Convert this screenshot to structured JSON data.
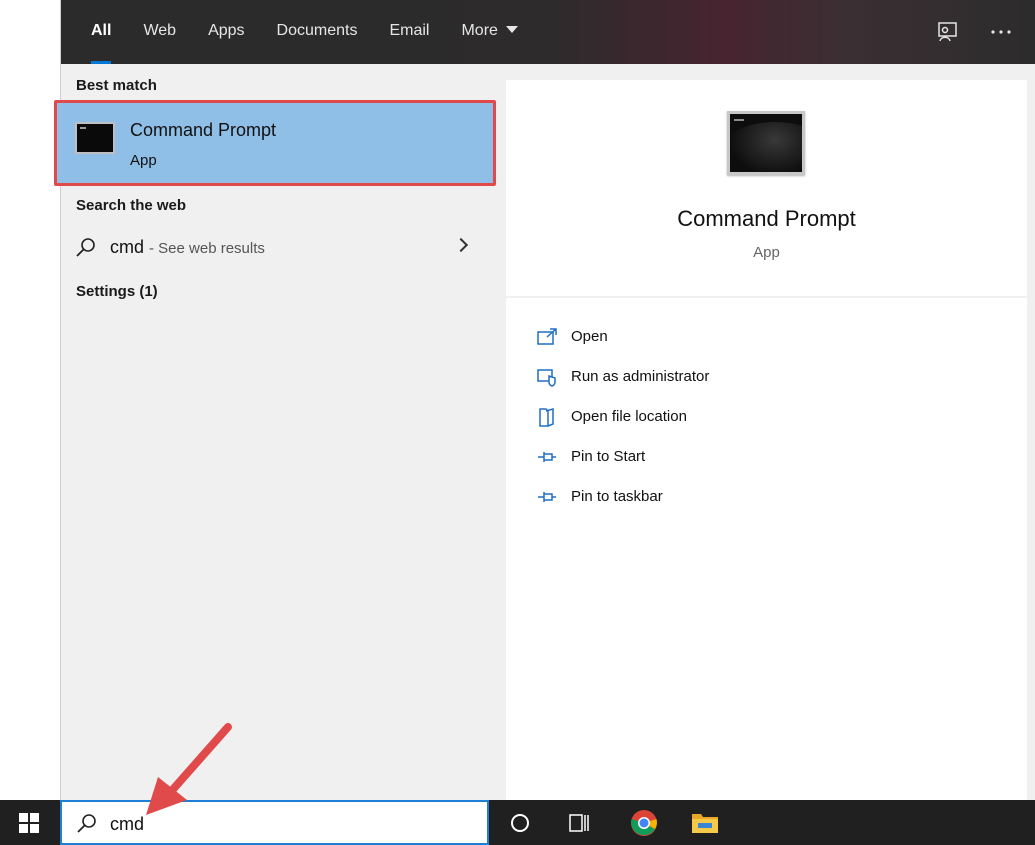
{
  "header": {
    "tabs": [
      {
        "label": "All"
      },
      {
        "label": "Web"
      },
      {
        "label": "Apps"
      },
      {
        "label": "Documents"
      },
      {
        "label": "Email"
      },
      {
        "label": "More"
      }
    ],
    "icons": [
      "feedback-icon",
      "more-options-icon"
    ]
  },
  "results": {
    "best_match_title": "Best match",
    "best_match": {
      "name": "Command Prompt",
      "type": "App"
    },
    "search_web_title": "Search the web",
    "web_result": {
      "query": "cmd",
      "hint": "- See web results"
    },
    "settings_title": "Settings (1)"
  },
  "preview": {
    "title": "Command Prompt",
    "subtitle": "App",
    "actions": [
      {
        "label": "Open",
        "icon": "open-icon"
      },
      {
        "label": "Run as administrator",
        "icon": "run-as-admin-icon"
      },
      {
        "label": "Open file location",
        "icon": "file-location-icon"
      },
      {
        "label": "Pin to Start",
        "icon": "pin-icon"
      },
      {
        "label": "Pin to taskbar",
        "icon": "pin-icon"
      }
    ]
  },
  "taskbar": {
    "search_value": "cmd",
    "icons": [
      "windows-start-icon",
      "search-icon",
      "cortana-icon",
      "task-view-icon",
      "chrome-icon",
      "file-explorer-icon"
    ]
  },
  "colors": {
    "highlight": "#8fbfe6",
    "accent": "#0078d7",
    "annotation": "#e04a4a"
  }
}
